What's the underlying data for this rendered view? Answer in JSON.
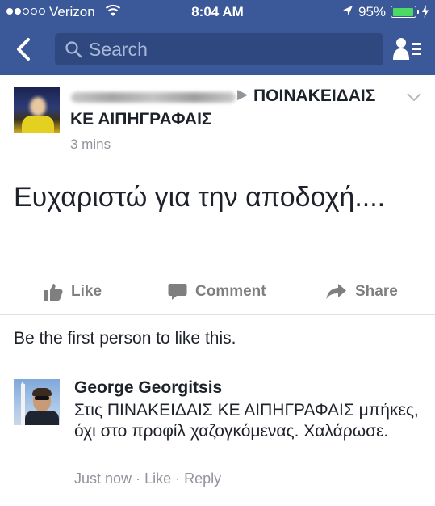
{
  "status_bar": {
    "carrier": "Verizon",
    "time": "8:04 AM",
    "battery_percent": "95%",
    "battery_level": 0.95,
    "signal_bars_filled": 2,
    "signal_bars_total": 5
  },
  "nav": {
    "search_placeholder": "Search",
    "back_icon": "chevron-left-icon",
    "friends_icon": "friend-requests-icon",
    "bar_color": "#3b5998"
  },
  "post": {
    "group_line1": "ΠΟΙΝΑΚΕΙΔΑΙΣ",
    "group_line2": "ΚΕ ΑΙΠΗΓΡΑΦΑΙΣ",
    "time_ago": "3 mins",
    "text": "Ευχαριστώ για την αποδοχή...."
  },
  "actions": {
    "like": "Like",
    "comment": "Comment",
    "share": "Share"
  },
  "likes_text": "Be the first person to like this.",
  "comment": {
    "author": "George Georgitsis",
    "text": "Στις ΠΙΝΑΚΕΙΔΑΙΣ ΚΕ ΑΙΠΗΓΡΑΦΑΙΣ μπήκες, όχι στο προφίλ χαζογκόμενας. Χαλάρωσε.",
    "time": "Just now",
    "like": "Like",
    "reply": "Reply",
    "separator": "·"
  }
}
